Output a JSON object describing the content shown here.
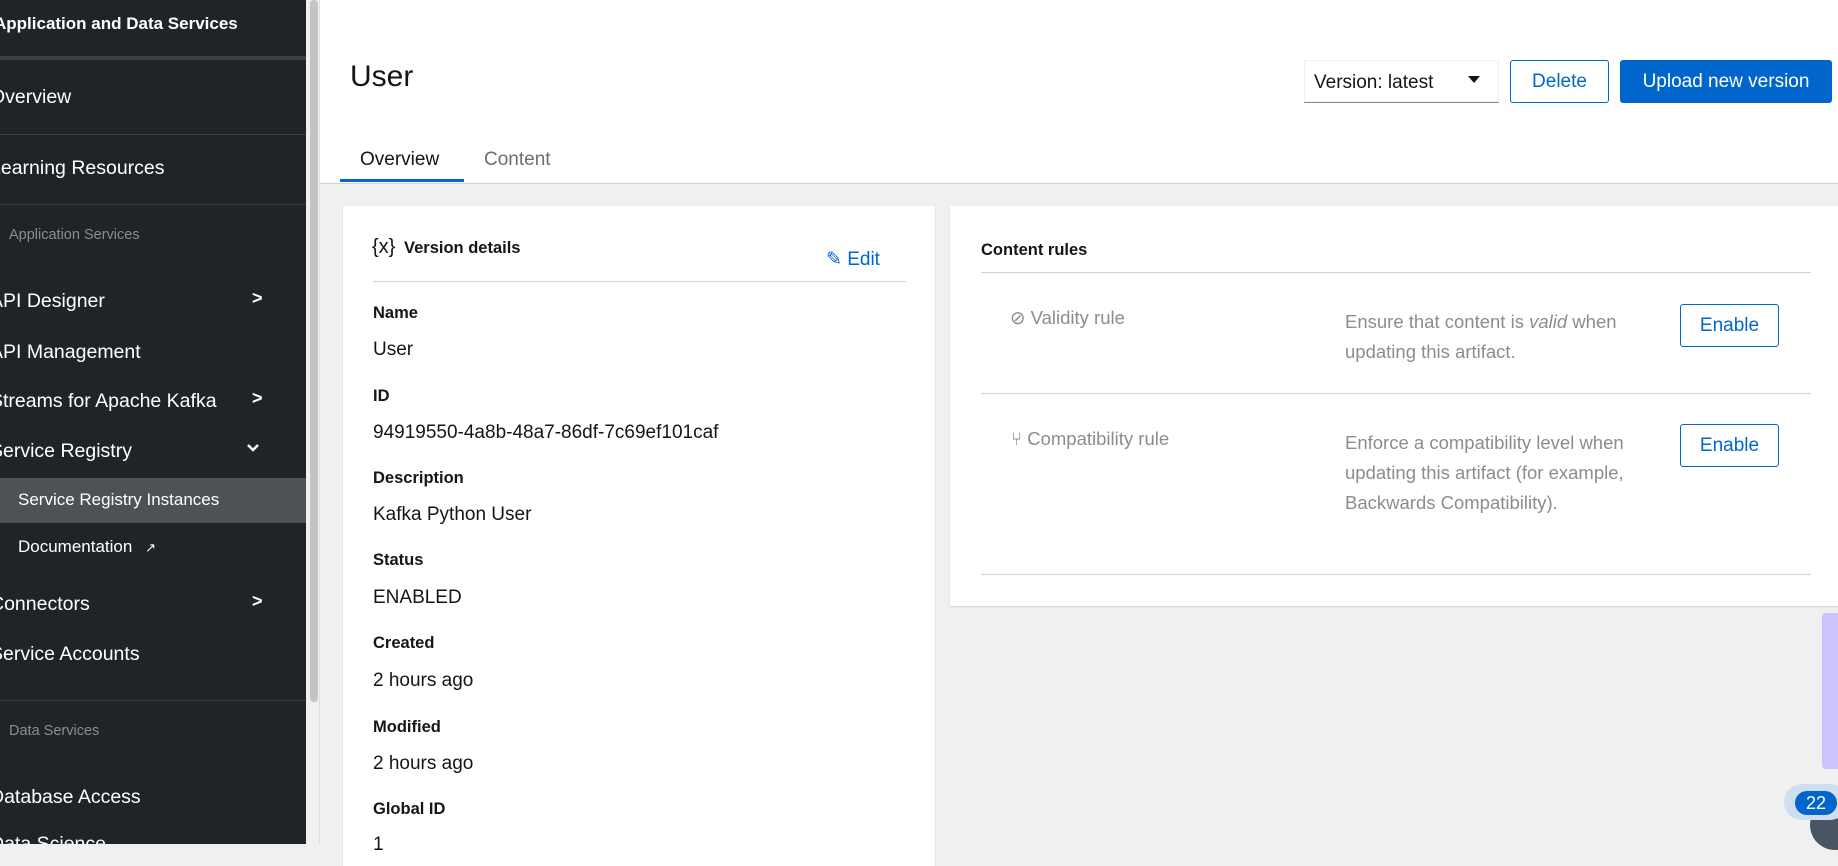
{
  "sidebar": {
    "title": "Application and Data Services",
    "items": [
      {
        "label": "Overview"
      },
      {
        "label": "Learning Resources"
      }
    ],
    "sections": [
      {
        "label": "Application Services",
        "items": [
          {
            "label": "API Designer"
          },
          {
            "label": "API Management"
          },
          {
            "label": "Streams for Apache Kafka"
          },
          {
            "label": "Service Registry"
          },
          {
            "label": "Service Registry Instances"
          },
          {
            "label": "Documentation"
          },
          {
            "label": "Connectors"
          },
          {
            "label": "Service Accounts"
          }
        ]
      },
      {
        "label": "Data Services",
        "items": [
          {
            "label": "Database Access"
          },
          {
            "label": "Data Science"
          }
        ]
      }
    ]
  },
  "header": {
    "title": "User",
    "version_select": "Version: latest",
    "delete_label": "Delete",
    "upload_label": "Upload new version",
    "tabs": [
      {
        "label": "Overview"
      },
      {
        "label": "Content"
      }
    ]
  },
  "details": {
    "title": "Version details",
    "edit_label": "Edit",
    "fields": [
      {
        "label": "Name",
        "value": "User"
      },
      {
        "label": "ID",
        "value": "94919550-4a8b-48a7-86df-7c69ef101caf"
      },
      {
        "label": "Description",
        "value": "Kafka Python User"
      },
      {
        "label": "Status",
        "value": "ENABLED"
      },
      {
        "label": "Created",
        "value": "2 hours ago"
      },
      {
        "label": "Modified",
        "value": "2 hours ago"
      },
      {
        "label": "Global ID",
        "value": "1"
      }
    ]
  },
  "rules": {
    "title": "Content rules",
    "validity": {
      "label": "Validity rule",
      "desc_pre": "Ensure that content is ",
      "desc_em": "valid",
      "desc_post": " when updating this artifact.",
      "button": "Enable"
    },
    "compatibility": {
      "label": "Compatibility rule",
      "desc": "Enforce a compatibility level when updating this artifact (for example, Backwards Compatibility).",
      "button": "Enable"
    }
  },
  "notification_badge": "22",
  "colors": {
    "accent": "#0066cc",
    "sidebar_bg": "#212427"
  }
}
